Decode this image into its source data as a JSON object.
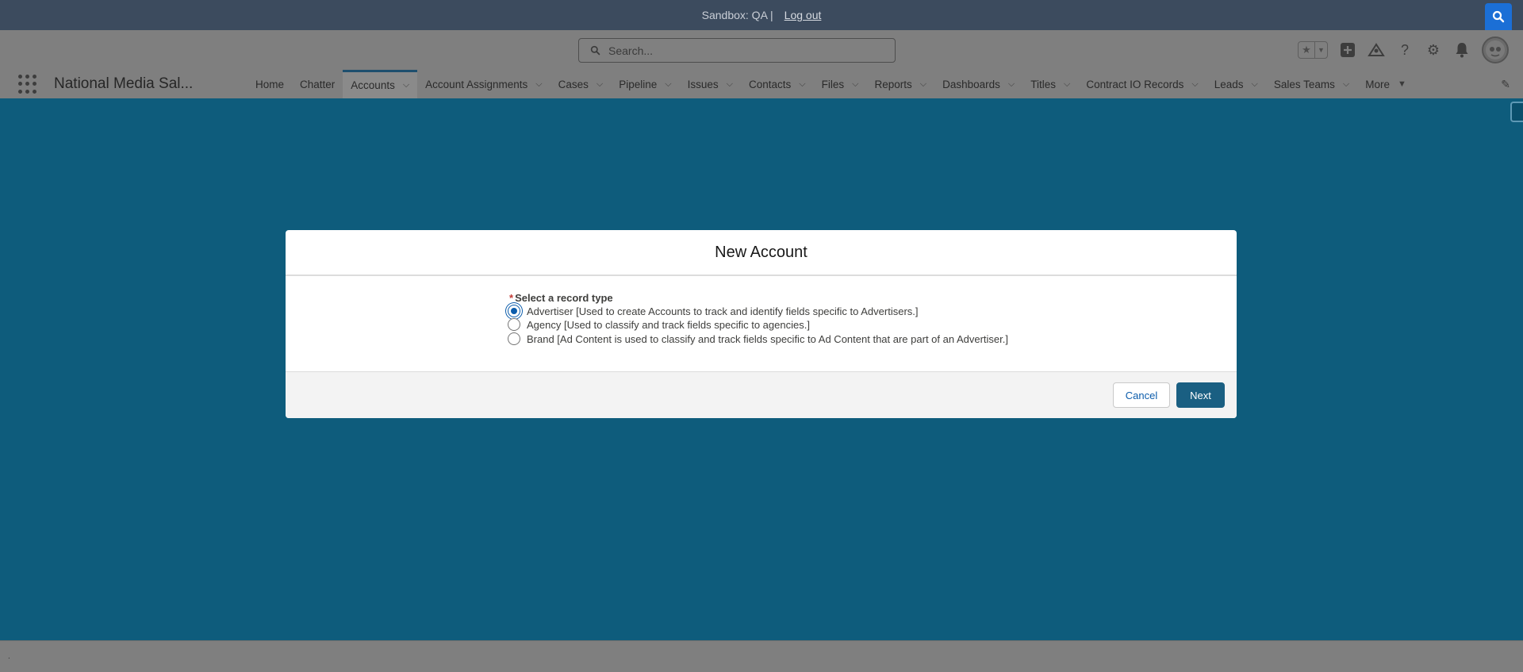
{
  "sandbox": {
    "text": "Sandbox: QA |",
    "logout_label": "Log out"
  },
  "search": {
    "placeholder": "Search..."
  },
  "app": {
    "name": "National Media Sal..."
  },
  "nav": {
    "items": [
      {
        "label": "Home",
        "has_menu": false,
        "active": false
      },
      {
        "label": "Chatter",
        "has_menu": false,
        "active": false
      },
      {
        "label": "Accounts",
        "has_menu": true,
        "active": true
      },
      {
        "label": "Account Assignments",
        "has_menu": true,
        "active": false
      },
      {
        "label": "Cases",
        "has_menu": true,
        "active": false
      },
      {
        "label": "Pipeline",
        "has_menu": true,
        "active": false
      },
      {
        "label": "Issues",
        "has_menu": true,
        "active": false
      },
      {
        "label": "Contacts",
        "has_menu": true,
        "active": false
      },
      {
        "label": "Files",
        "has_menu": true,
        "active": false
      },
      {
        "label": "Reports",
        "has_menu": true,
        "active": false
      },
      {
        "label": "Dashboards",
        "has_menu": true,
        "active": false
      },
      {
        "label": "Titles",
        "has_menu": true,
        "active": false
      },
      {
        "label": "Contract IO Records",
        "has_menu": true,
        "active": false
      },
      {
        "label": "Leads",
        "has_menu": true,
        "active": false
      },
      {
        "label": "Sales Teams",
        "has_menu": true,
        "active": false
      }
    ],
    "more_label": "More"
  },
  "modal": {
    "title": "New Account",
    "field_label": "Select a record type",
    "required_marker": "*",
    "options": [
      {
        "label": "Advertiser [Used to create Accounts to track and identify fields specific to Advertisers.]",
        "checked": true
      },
      {
        "label": "Agency [Used to classify and track fields specific to agencies.]",
        "checked": false
      },
      {
        "label": "Brand [Ad Content is used to classify and track fields specific to Ad Content that are part of an Advertiser.]",
        "checked": false
      }
    ],
    "cancel_label": "Cancel",
    "next_label": "Next"
  },
  "utility": {
    "text": "."
  },
  "colors": {
    "backdrop": "#0e5c7c",
    "brand_button": "#1a5f82",
    "sandbox_bar": "#3c4b5e",
    "search_accent": "#1b6fd6"
  }
}
